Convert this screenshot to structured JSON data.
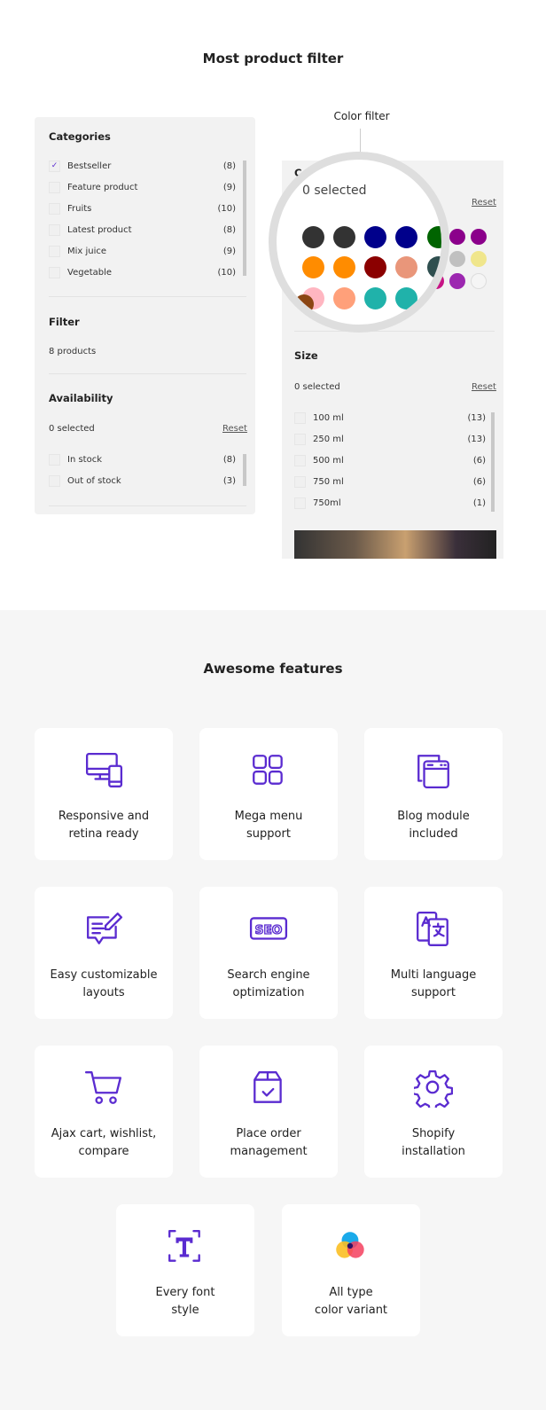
{
  "filter_section": {
    "title": "Most product filter",
    "callout": "Color filter"
  },
  "categories": {
    "title": "Categories",
    "items": [
      {
        "label": "Bestseller",
        "count": "(8)",
        "checked": true
      },
      {
        "label": "Feature product",
        "count": "(9)"
      },
      {
        "label": "Fruits",
        "count": "(10)"
      },
      {
        "label": "Latest product",
        "count": "(8)"
      },
      {
        "label": "Mix juice",
        "count": "(9)"
      },
      {
        "label": "Vegetable",
        "count": "(10)"
      }
    ]
  },
  "filter": {
    "title": "Filter",
    "text": "8 products"
  },
  "availability": {
    "title": "Availability",
    "selected": "0 selected",
    "reset": "Reset",
    "items": [
      {
        "label": "In stock",
        "count": "(8)"
      },
      {
        "label": "Out of stock",
        "count": "(3)"
      }
    ]
  },
  "color": {
    "title": "Color",
    "selected": "0 selected",
    "reset": "Reset",
    "swatches": [
      "#333333",
      "#333333",
      "#00008b",
      "#00008b",
      "#006400",
      "#8b008b",
      "#8b008b",
      "#ff8c00",
      "#ff8c00",
      "#8b0000",
      "#e9967a",
      "#2f4f4f",
      "#f0e68c",
      "#c0c0c0",
      "#ffb6c1",
      "#ffa07a",
      "#20b2aa",
      "#20b2aa",
      "#c71585",
      "#9c27b0",
      "#f5f5f5",
      "#8b4513"
    ]
  },
  "size": {
    "title": "Size",
    "selected": "0 selected",
    "reset": "Reset",
    "items": [
      {
        "label": "100 ml",
        "count": "(13)"
      },
      {
        "label": "250 ml",
        "count": "(13)"
      },
      {
        "label": "500 ml",
        "count": "(6)"
      },
      {
        "label": "750 ml",
        "count": "(6)"
      },
      {
        "label": "750ml",
        "count": "(1)"
      }
    ]
  },
  "features": {
    "title": "Awesome features",
    "accent": "#5a2bd0",
    "items": [
      {
        "icon": "responsive-icon",
        "line1": "Responsive and",
        "line2": "retina ready"
      },
      {
        "icon": "grid-icon",
        "line1": "Mega menu",
        "line2": "support"
      },
      {
        "icon": "blog-icon",
        "line1": "Blog module",
        "line2": "included"
      },
      {
        "icon": "edit-layout-icon",
        "line1": "Easy customizable",
        "line2": "layouts"
      },
      {
        "icon": "seo-icon",
        "line1": "Search engine",
        "line2": "optimization"
      },
      {
        "icon": "translate-icon",
        "line1": "Multi language",
        "line2": "support"
      },
      {
        "icon": "cart-icon",
        "line1": "Ajax cart, wishlist,",
        "line2": "compare"
      },
      {
        "icon": "box-icon",
        "line1": "Place order",
        "line2": "management"
      },
      {
        "icon": "gear-icon",
        "line1": "Shopify",
        "line2": "installation"
      },
      {
        "icon": "font-icon",
        "line1": "Every font",
        "line2": "style"
      },
      {
        "icon": "color-icon",
        "line1": "All type",
        "line2": "color variant"
      }
    ]
  }
}
